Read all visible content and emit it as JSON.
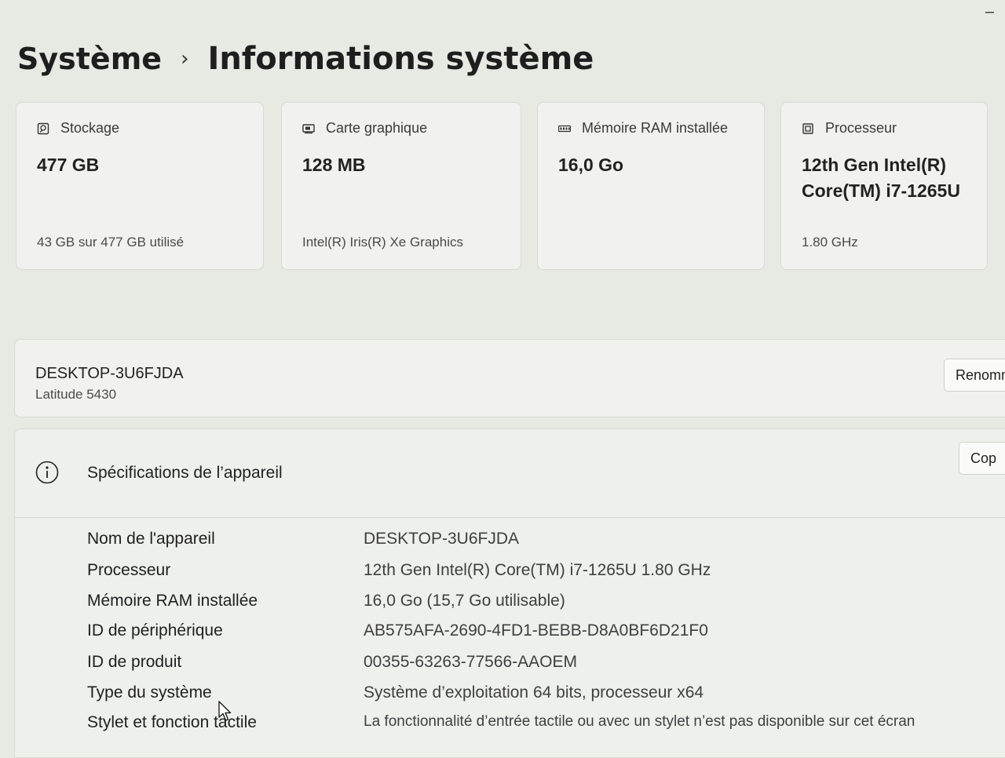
{
  "breadcrumb": {
    "root": "Système",
    "separator": "›",
    "current": "Informations système"
  },
  "cards": [
    {
      "icon": "storage-icon",
      "title": "Stockage",
      "value": "477 GB",
      "subtitle": "43 GB sur 477 GB utilisé"
    },
    {
      "icon": "graphics-card-icon",
      "title": "Carte graphique",
      "value": "128 MB",
      "subtitle": "Intel(R) Iris(R) Xe Graphics"
    },
    {
      "icon": "ram-icon",
      "title": "Mémoire RAM installée",
      "value": "16,0 Go",
      "subtitle": ""
    },
    {
      "icon": "processor-icon",
      "title": "Processeur",
      "value_line1": "12th Gen Intel(R)",
      "value_line2": "Core(TM) i7-1265U",
      "subtitle": "1.80 GHz"
    }
  ],
  "device": {
    "name": "DESKTOP-3U6FJDA",
    "model": "Latitude 5430",
    "rename_label": "Renomm"
  },
  "specs": {
    "title": "Spécifications de l’appareil",
    "copy_label": "Cop",
    "rows": [
      {
        "label": "Nom de l'appareil",
        "value": "DESKTOP-3U6FJDA"
      },
      {
        "label": "Processeur",
        "value": "12th Gen Intel(R) Core(TM) i7-1265U   1.80 GHz"
      },
      {
        "label": "Mémoire RAM installée",
        "value": "16,0 Go (15,7 Go utilisable)"
      },
      {
        "label": "ID de périphérique",
        "value": "AB575AFA-2690-4FD1-BEBB-D8A0BF6D21F0"
      },
      {
        "label": "ID de produit",
        "value": "00355-63263-77566-AAOEM"
      },
      {
        "label": "Type du système",
        "value": "Système d’exploitation 64 bits, processeur x64"
      },
      {
        "label": "Stylet et fonction tactile",
        "value": "La fonctionnalité d’entrée tactile ou avec un stylet n’est pas disponible sur cet écran"
      }
    ]
  },
  "window": {
    "minimize_glyph": "–"
  }
}
